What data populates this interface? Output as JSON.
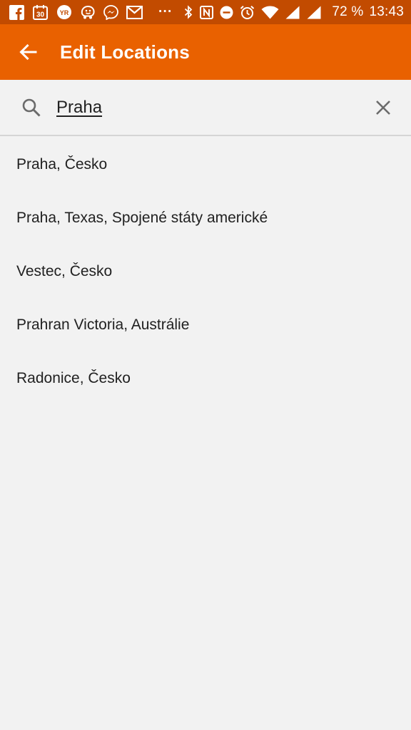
{
  "status_bar": {
    "left_icons": [
      "facebook-icon",
      "calendar-icon",
      "yr-weather-icon",
      "waze-icon",
      "messenger-icon",
      "gmail-icon"
    ],
    "calendar_day": "30",
    "yr_label": "YR",
    "more": "···",
    "right_icons": [
      "bluetooth-icon",
      "nfc-icon",
      "do-not-disturb-icon",
      "alarm-icon",
      "wifi-icon",
      "signal-icon",
      "signal-icon"
    ],
    "battery": "72 %",
    "time": "13:43"
  },
  "app_bar": {
    "title": "Edit Locations",
    "back_icon": "arrow-back-icon",
    "color": "#e96100",
    "status_color": "#c24b00"
  },
  "search": {
    "value": "Praha",
    "search_icon": "search-icon",
    "clear_icon": "close-icon"
  },
  "results": [
    {
      "label": "Praha, Česko"
    },
    {
      "label": "Praha, Texas, Spojené státy americké"
    },
    {
      "label": "Vestec, Česko"
    },
    {
      "label": "Prahran Victoria, Austrálie"
    },
    {
      "label": "Radonice, Česko"
    }
  ]
}
